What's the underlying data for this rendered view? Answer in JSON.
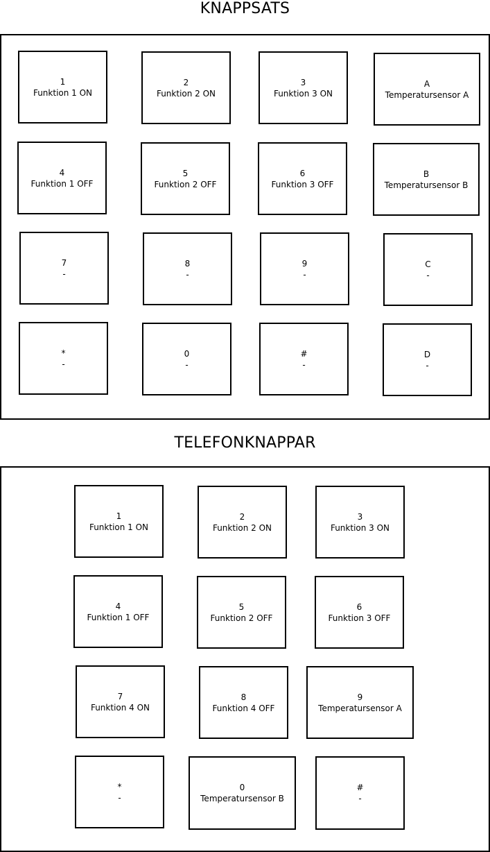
{
  "keypad": {
    "title": "KNAPPSATS",
    "keys": [
      {
        "symbol": "1",
        "label": "Funktion 1 ON"
      },
      {
        "symbol": "2",
        "label": "Funktion 2 ON"
      },
      {
        "symbol": "3",
        "label": "Funktion 3 ON"
      },
      {
        "symbol": "A",
        "label": "Temperatursensor A"
      },
      {
        "symbol": "4",
        "label": "Funktion 1 OFF"
      },
      {
        "symbol": "5",
        "label": "Funktion 2 OFF"
      },
      {
        "symbol": "6",
        "label": "Funktion 3 OFF"
      },
      {
        "symbol": "B",
        "label": "Temperatursensor B"
      },
      {
        "symbol": "7",
        "label": "-"
      },
      {
        "symbol": "8",
        "label": "-"
      },
      {
        "symbol": "9",
        "label": "-"
      },
      {
        "symbol": "C",
        "label": "-"
      },
      {
        "symbol": "*",
        "label": "-"
      },
      {
        "symbol": "0",
        "label": "-"
      },
      {
        "symbol": "#",
        "label": "-"
      },
      {
        "symbol": "D",
        "label": "-"
      }
    ]
  },
  "phone_keys": {
    "title": "TELEFONKNAPPAR",
    "keys": [
      {
        "symbol": "1",
        "label": "Funktion 1 ON"
      },
      {
        "symbol": "2",
        "label": "Funktion 2 ON"
      },
      {
        "symbol": "3",
        "label": "Funktion 3 ON"
      },
      {
        "symbol": "4",
        "label": "Funktion 1 OFF"
      },
      {
        "symbol": "5",
        "label": "Funktion 2 OFF"
      },
      {
        "symbol": "6",
        "label": "Funktion 3 OFF"
      },
      {
        "symbol": "7",
        "label": "Funktion 4 ON"
      },
      {
        "symbol": "8",
        "label": "Funktion 4 OFF"
      },
      {
        "symbol": "9",
        "label": "Temperatursensor A"
      },
      {
        "symbol": "*",
        "label": "-"
      },
      {
        "symbol": "0",
        "label": "Temperatursensor B"
      },
      {
        "symbol": "#",
        "label": "-"
      }
    ]
  }
}
